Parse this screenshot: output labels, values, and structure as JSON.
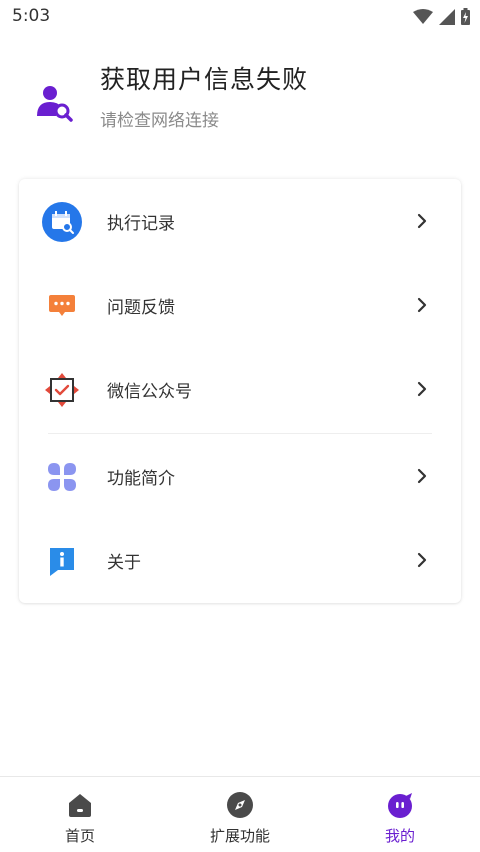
{
  "status_bar": {
    "time": "5:03"
  },
  "profile": {
    "title": "获取用户信息失败",
    "subtitle": "请检查网络连接"
  },
  "menu": {
    "items": [
      {
        "label": "执行记录",
        "icon": "calendar-search-icon"
      },
      {
        "label": "问题反馈",
        "icon": "chat-bubble-icon"
      },
      {
        "label": "微信公众号",
        "icon": "check-box-icon"
      },
      {
        "label": "功能简介",
        "icon": "grid-four-icon"
      },
      {
        "label": "关于",
        "icon": "info-icon"
      }
    ]
  },
  "bottom_nav": {
    "items": [
      {
        "label": "首页",
        "icon": "home-icon",
        "active": false
      },
      {
        "label": "扩展功能",
        "icon": "compass-icon",
        "active": false
      },
      {
        "label": "我的",
        "icon": "face-icon",
        "active": true
      }
    ]
  },
  "colors": {
    "accent": "#6a1fd0",
    "blue": "#2577e9",
    "orange": "#f4803a",
    "red": "#e24a3b",
    "lavender": "#8b95f0"
  }
}
